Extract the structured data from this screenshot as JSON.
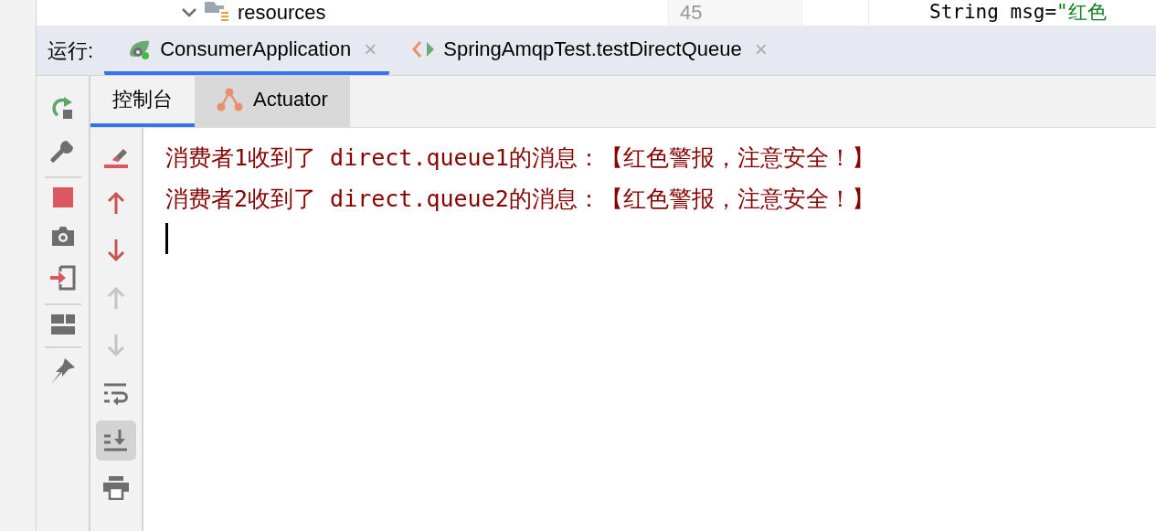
{
  "editor": {
    "tree_item": {
      "label": "resources",
      "expanded": true
    },
    "line_number": "45",
    "code_line": "String msg=\"红色"
  },
  "run_panel": {
    "label": "运行:",
    "tabs": [
      {
        "label": "ConsumerApplication",
        "kind": "spring",
        "selected": true,
        "close": "×"
      },
      {
        "label": "SpringAmqpTest.testDirectQueue",
        "kind": "test",
        "selected": false,
        "close": "×"
      }
    ]
  },
  "sub_tabs": [
    {
      "label": "控制台",
      "kind": "console",
      "selected": true
    },
    {
      "label": "Actuator",
      "kind": "actuator",
      "selected": false
    }
  ],
  "console_tools": [
    {
      "kind": "clear",
      "disabled": false,
      "on": false
    },
    {
      "kind": "up",
      "disabled": false,
      "on": false
    },
    {
      "kind": "down",
      "disabled": false,
      "on": false
    },
    {
      "kind": "up",
      "disabled": true,
      "on": false
    },
    {
      "kind": "down",
      "disabled": true,
      "on": false
    },
    {
      "kind": "wrap",
      "disabled": false,
      "on": false
    },
    {
      "kind": "scroll",
      "disabled": false,
      "on": true
    },
    {
      "kind": "print",
      "disabled": false,
      "on": false
    }
  ],
  "console": {
    "lines": [
      "消费者1收到了 direct.queue1的消息：【红色警报，注意安全！】",
      "消费者2收到了 direct.queue2的消息：【红色警报，注意安全！】"
    ]
  }
}
